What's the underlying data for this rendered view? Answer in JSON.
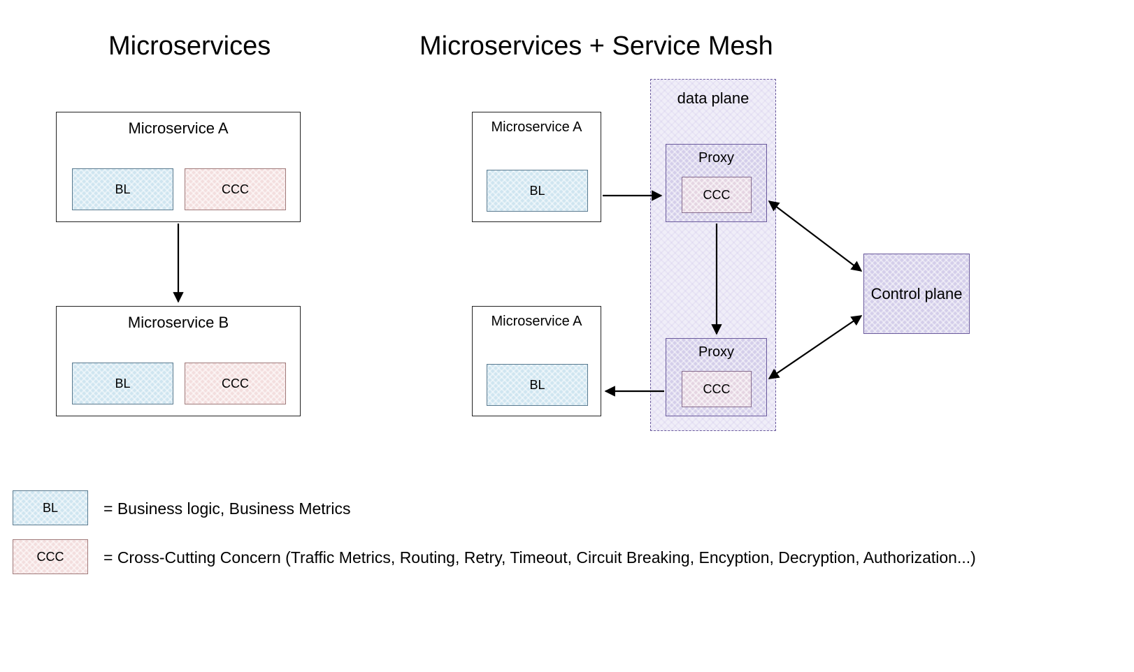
{
  "headings": {
    "left": "Microservices",
    "right": "Microservices + Service Mesh"
  },
  "left": {
    "serviceA": {
      "title": "Microservice A",
      "bl": "BL",
      "ccc": "CCC"
    },
    "serviceB": {
      "title": "Microservice B",
      "bl": "BL",
      "ccc": "CCC"
    }
  },
  "right": {
    "dataPlaneLabel": "data plane",
    "serviceA": {
      "title": "Microservice A",
      "bl": "BL"
    },
    "serviceB": {
      "title": "Microservice A",
      "bl": "BL"
    },
    "proxy1": {
      "title": "Proxy",
      "ccc": "CCC"
    },
    "proxy2": {
      "title": "Proxy",
      "ccc": "CCC"
    },
    "controlPlane": "Control plane"
  },
  "legend": {
    "bl": {
      "abbrev": "BL",
      "desc": "= Business logic, Business Metrics"
    },
    "ccc": {
      "abbrev": "CCC",
      "desc": "= Cross-Cutting Concern (Traffic Metrics, Routing, Retry, Timeout, Circuit Breaking, Encyption, Decryption, Authorization...)"
    }
  },
  "colors": {
    "bl": "#cfe5f0",
    "ccc": "#f3dede",
    "proxy": "#d4ceea",
    "cccInner": "#e5d5e2"
  }
}
